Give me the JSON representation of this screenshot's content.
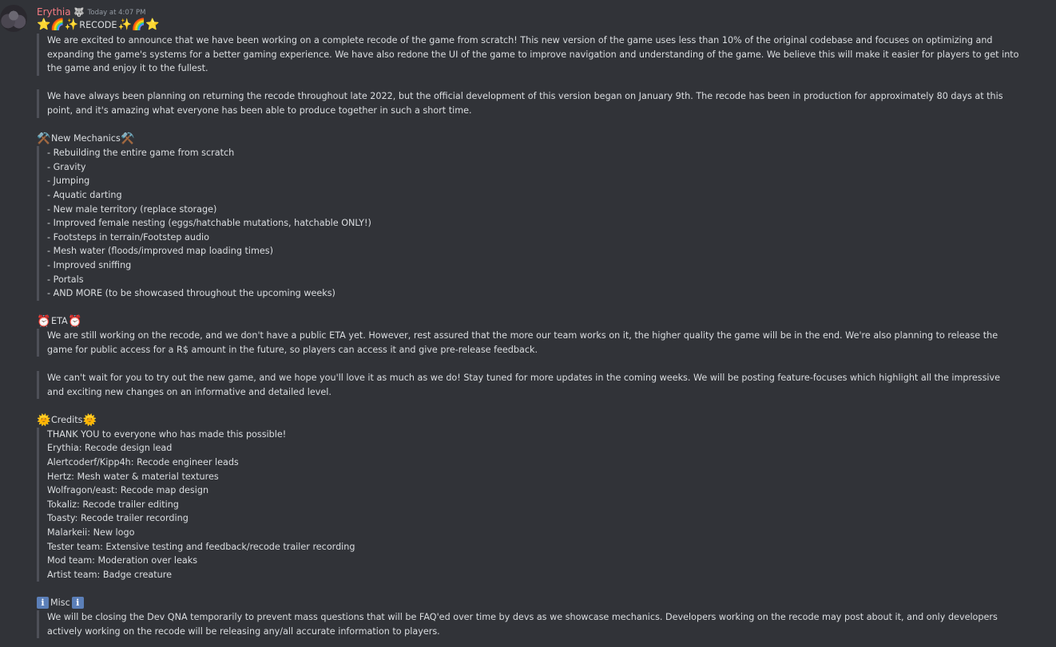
{
  "message": {
    "author": "Erythia",
    "author_badge_icon": "wolf-badge-icon",
    "author_badge_glyph": "🐺",
    "timestamp": "Today at 4:07 PM",
    "title": {
      "emoji_left": "⭐🌈✨",
      "text": "RECODE",
      "emoji_right": "✨🌈⭐"
    },
    "intro_paragraph": "We are excited to announce that we have been working on a complete recode of the game from scratch! This new version of the game uses less than 10% of the original codebase and focuses on optimizing and expanding the game's systems for a better gaming experience. We have also redone the UI of the game to improve navigation and understanding of the game. We believe this will make it easier for players to get into the game and enjoy it to the fullest.",
    "timeline_paragraph": "We have always been planning on returning the recode throughout late 2022, but the official development of this version began on January 9th. The recode has been in production for approximately 80 days at this point, and it's amazing what everyone has been able to produce together in such a short time.",
    "mechanics": {
      "emoji": "⚒️",
      "heading": "New Mechanics",
      "items": [
        "- Rebuilding the entire game from scratch",
        "- Gravity",
        "- Jumping",
        "- Aquatic darting",
        "- New male territory (replace storage)",
        "- Improved female nesting (eggs/hatchable mutations, hatchable ONLY!)",
        "- Footsteps in terrain/Footstep audio",
        "- Mesh water (floods/improved map loading times)",
        "- Improved sniffing",
        "- Portals",
        "- AND MORE (to be showcased throughout the upcoming weeks)"
      ]
    },
    "eta": {
      "emoji": "⏰",
      "heading": "ETA",
      "paragraph": "We are still working on the recode, and we don't have a public ETA yet. However, rest assured that the more our team works on it, the higher quality the game will be in the end. We're also planning to release the game for public access for a R$ amount in the future, so players can access it and give pre-release feedback.",
      "closing_paragraph": "We can't wait for you to try out the new game, and we hope you'll love it as much as we do! Stay tuned for more updates in the coming weeks. We will be posting feature-focuses which highlight all the impressive and exciting new changes on an informative and detailed level."
    },
    "credits": {
      "emoji": "🌞",
      "heading": "Credits",
      "items": [
        "THANK YOU to everyone who has made this possible!",
        "Erythia: Recode design lead",
        "Alertcoderf/Kipp4h: Recode engineer leads",
        "Hertz: Mesh water & material textures",
        "Wolfragon/east: Recode map design",
        "Tokaliz: Recode trailer editing",
        "Toasty: Recode trailer recording",
        "Malarkeii: New logo",
        "Tester team: Extensive testing and feedback/recode trailer recording",
        "Mod team: Moderation over leaks",
        "Artist team: Badge creature"
      ]
    },
    "misc": {
      "emoji": "i",
      "heading": "Misc",
      "paragraph": "We will be closing the Dev QNA temporarily to prevent mass questions that will be FAQ'ed over time by devs as we showcase mechanics. Developers working on the recode may post about it, and only developers actively working on the recode will be releasing any/all accurate information to players."
    }
  }
}
